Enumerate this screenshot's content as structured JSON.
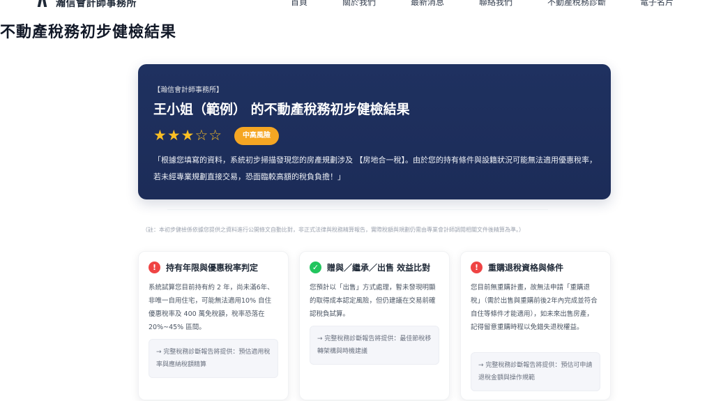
{
  "nav": {
    "brand": "瀚信會計師事務所",
    "items": [
      "首頁",
      "關於我們",
      "最新消息",
      "聯絡我們",
      "不動產稅務診斷",
      "電子名片"
    ]
  },
  "page": {
    "title": "不動產稅務初步健檢結果"
  },
  "hero": {
    "firm": "【瀚信會計師事務所】",
    "title": "王小姐（範例） 的不動產稅務初步健檢結果",
    "rating": 3,
    "rating_max": 5,
    "stars_filled": "★★★",
    "stars_empty": "☆☆",
    "risk_label": "中高風險",
    "description": "「根據您填寫的資料，系統初步掃描發現您的房產規劃涉及 【房地合一稅】。由於您的持有條件與設籍狀況可能無法適用優惠稅率，若未經專業規劃直接交易，恐面臨較高額的稅負負擔！」"
  },
  "note": "（註：本初步健檢係依據您提供之資料進行公開條文自動比對，非正式法律與稅務精算報告，實際稅額與規劃仍需由專業會計師調閱相關文件後精算為準。）",
  "cards": [
    {
      "status": "warning",
      "icon_glyph": "!",
      "title": "持有年限與優惠稅率判定",
      "body": "系統試算您目前持有約 2 年，尚未滿6年、非唯一自用住宅，可能無法適用10% 自住優惠稅率及 400 萬免稅額，稅率恐落在 20%~45% 區間。",
      "box": "→ 完整稅務診斷報告將提供：預估適用稅率與應納稅額精算"
    },
    {
      "status": "ok",
      "icon_glyph": "✓",
      "title": "贈與／繼承／出售 效益比對",
      "body": "您預計以「出售」方式處理，暫未發現明顯的取得成本認定風險，但仍建議在交易前確認稅負試算。",
      "box": "→ 完整稅務診斷報告將提供：最佳節稅移轉架構與時機建議"
    },
    {
      "status": "warning",
      "icon_glyph": "!",
      "title": "重購退稅資格與條件",
      "body": "您目前無重購計畫，故無法申請「重購退稅」（需於出售與重購前後2年內完成並符合自住等條件才能適用），如未來出售房產，記得留意重購時程以免錯失退稅權益。",
      "box": "→ 完整稅務診斷報告將提供：預估可申請退稅金額與操作規範"
    }
  ],
  "colors": {
    "hero_bg": "#1f3160",
    "badge": "#f5a623",
    "star": "#fbbf24",
    "warning": "#ef4444",
    "ok": "#22c55e"
  }
}
